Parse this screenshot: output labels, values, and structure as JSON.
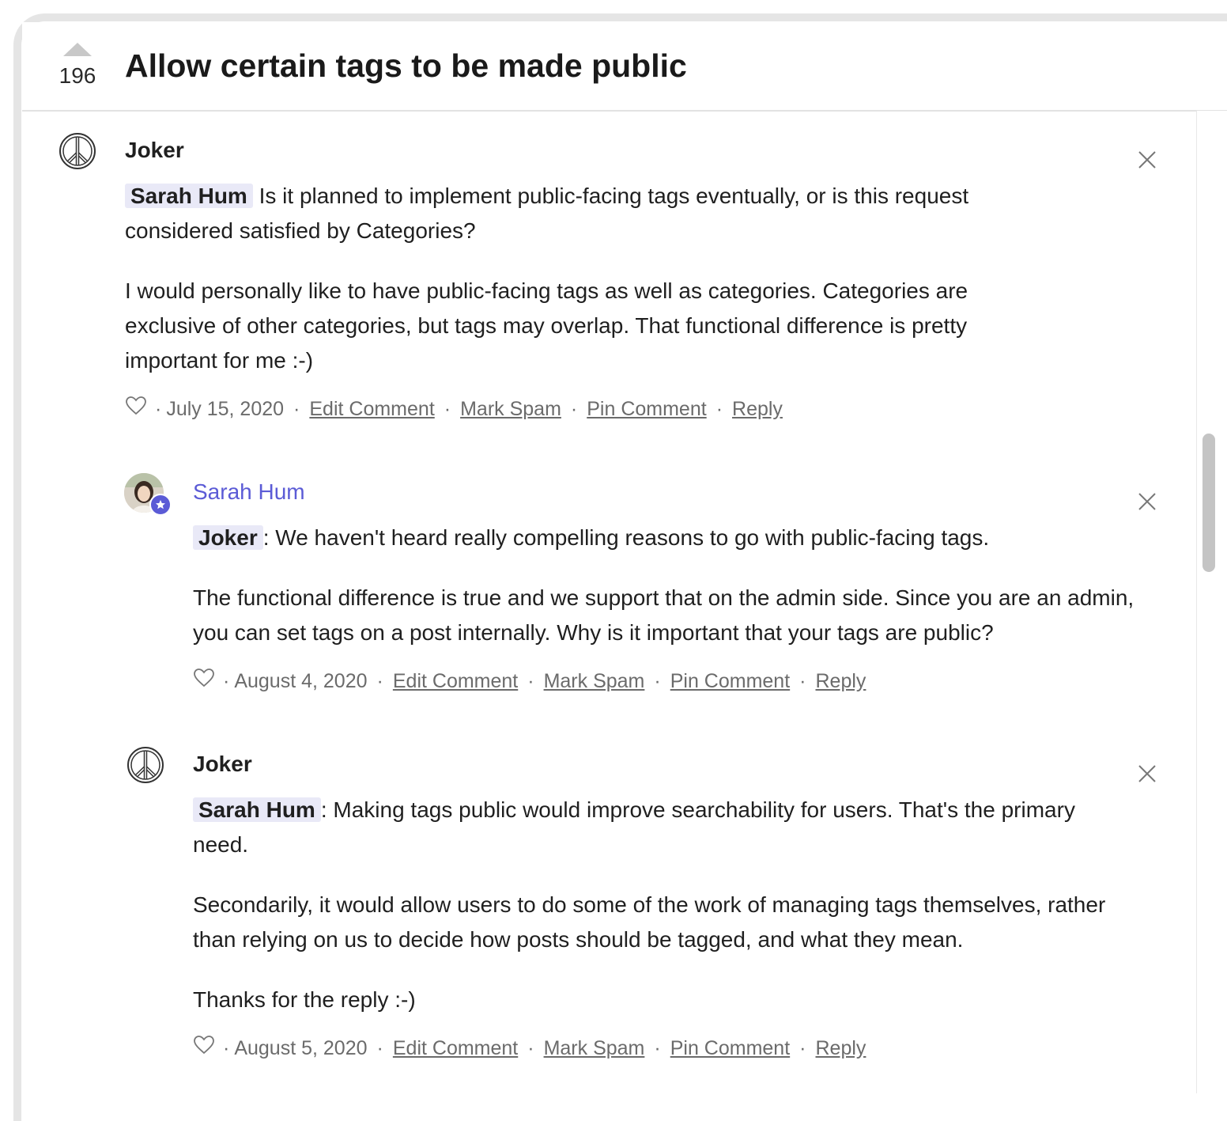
{
  "post": {
    "vote_count": "196",
    "title": "Allow certain tags to be made public"
  },
  "comments": [
    {
      "author": "Joker",
      "avatar_icon": "peace-icon",
      "mention": "Sarah Hum",
      "paragraphs": [
        " Is it planned to implement public-facing tags eventually, or is this request considered satisfied by Categories?",
        "I would personally like to have public-facing tags as well as categories.  Categories are exclusive of other categories, but tags may overlap. That functional difference is pretty important for me :-)"
      ],
      "date": "July 15, 2020",
      "actions": [
        "Edit Comment",
        "Mark Spam",
        "Pin Comment",
        "Reply"
      ]
    },
    {
      "author": "Sarah Hum",
      "avatar_icon": "user-photo",
      "is_admin": true,
      "mention": "Joker",
      "paragraphs": [
        ": We haven't heard really compelling reasons to go with public-facing tags.",
        "The functional difference is true and we support that on the admin side. Since you are an admin, you can set tags on a post internally. Why is it important that your tags are public?"
      ],
      "date": "August 4, 2020",
      "actions": [
        "Edit Comment",
        "Mark Spam",
        "Pin Comment",
        "Reply"
      ]
    },
    {
      "author": "Joker",
      "avatar_icon": "peace-icon",
      "mention": "Sarah Hum",
      "paragraphs": [
        ": Making tags public would improve searchability for users. That's the primary need.",
        "Secondarily, it would allow users to do some of the work of managing tags themselves, rather than relying on us to decide how posts should be tagged, and what they mean.",
        "Thanks for the reply :-)"
      ],
      "date": "August 5, 2020",
      "actions": [
        "Edit Comment",
        "Mark Spam",
        "Pin Comment",
        "Reply"
      ]
    }
  ],
  "colors": {
    "accent": "#5b5bd6",
    "mention_bg": "#e9e9f7",
    "muted_text": "#6b6b6b"
  }
}
